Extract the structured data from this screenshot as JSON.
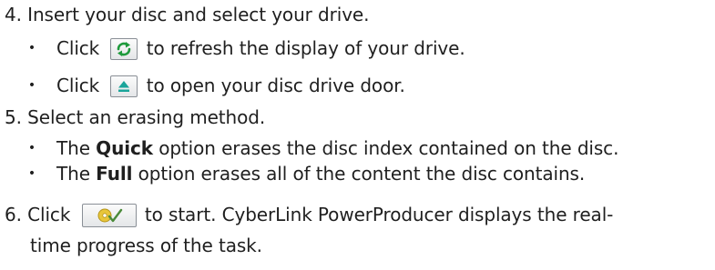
{
  "steps": [
    {
      "number": "4.",
      "text": "Insert your disc and select your drive.",
      "bullets": [
        {
          "before": "Click",
          "icon": "refresh-icon",
          "after": "to refresh the display of your drive."
        },
        {
          "before": "Click",
          "icon": "eject-icon",
          "after": "to open your disc drive door."
        }
      ]
    },
    {
      "number": "5.",
      "text": "Select an erasing method.",
      "bullets": [
        {
          "before": "The",
          "bold": "Quick",
          "after": "option erases the disc index contained on the disc."
        },
        {
          "before": "The",
          "bold": "Full",
          "after": "option erases all of the content the disc contains."
        }
      ]
    },
    {
      "number": "6.",
      "before": "Click",
      "icon": "start-icon",
      "after_line1": "to start. CyberLink PowerProducer displays the real-",
      "after_line2": "time progress of the task."
    }
  ],
  "bullet_glyph": "•",
  "colors": {
    "text": "#1f1f1f",
    "icon_green": "#1e9a3c",
    "icon_teal": "#1aa59a",
    "button_border": "#8a8f96"
  }
}
